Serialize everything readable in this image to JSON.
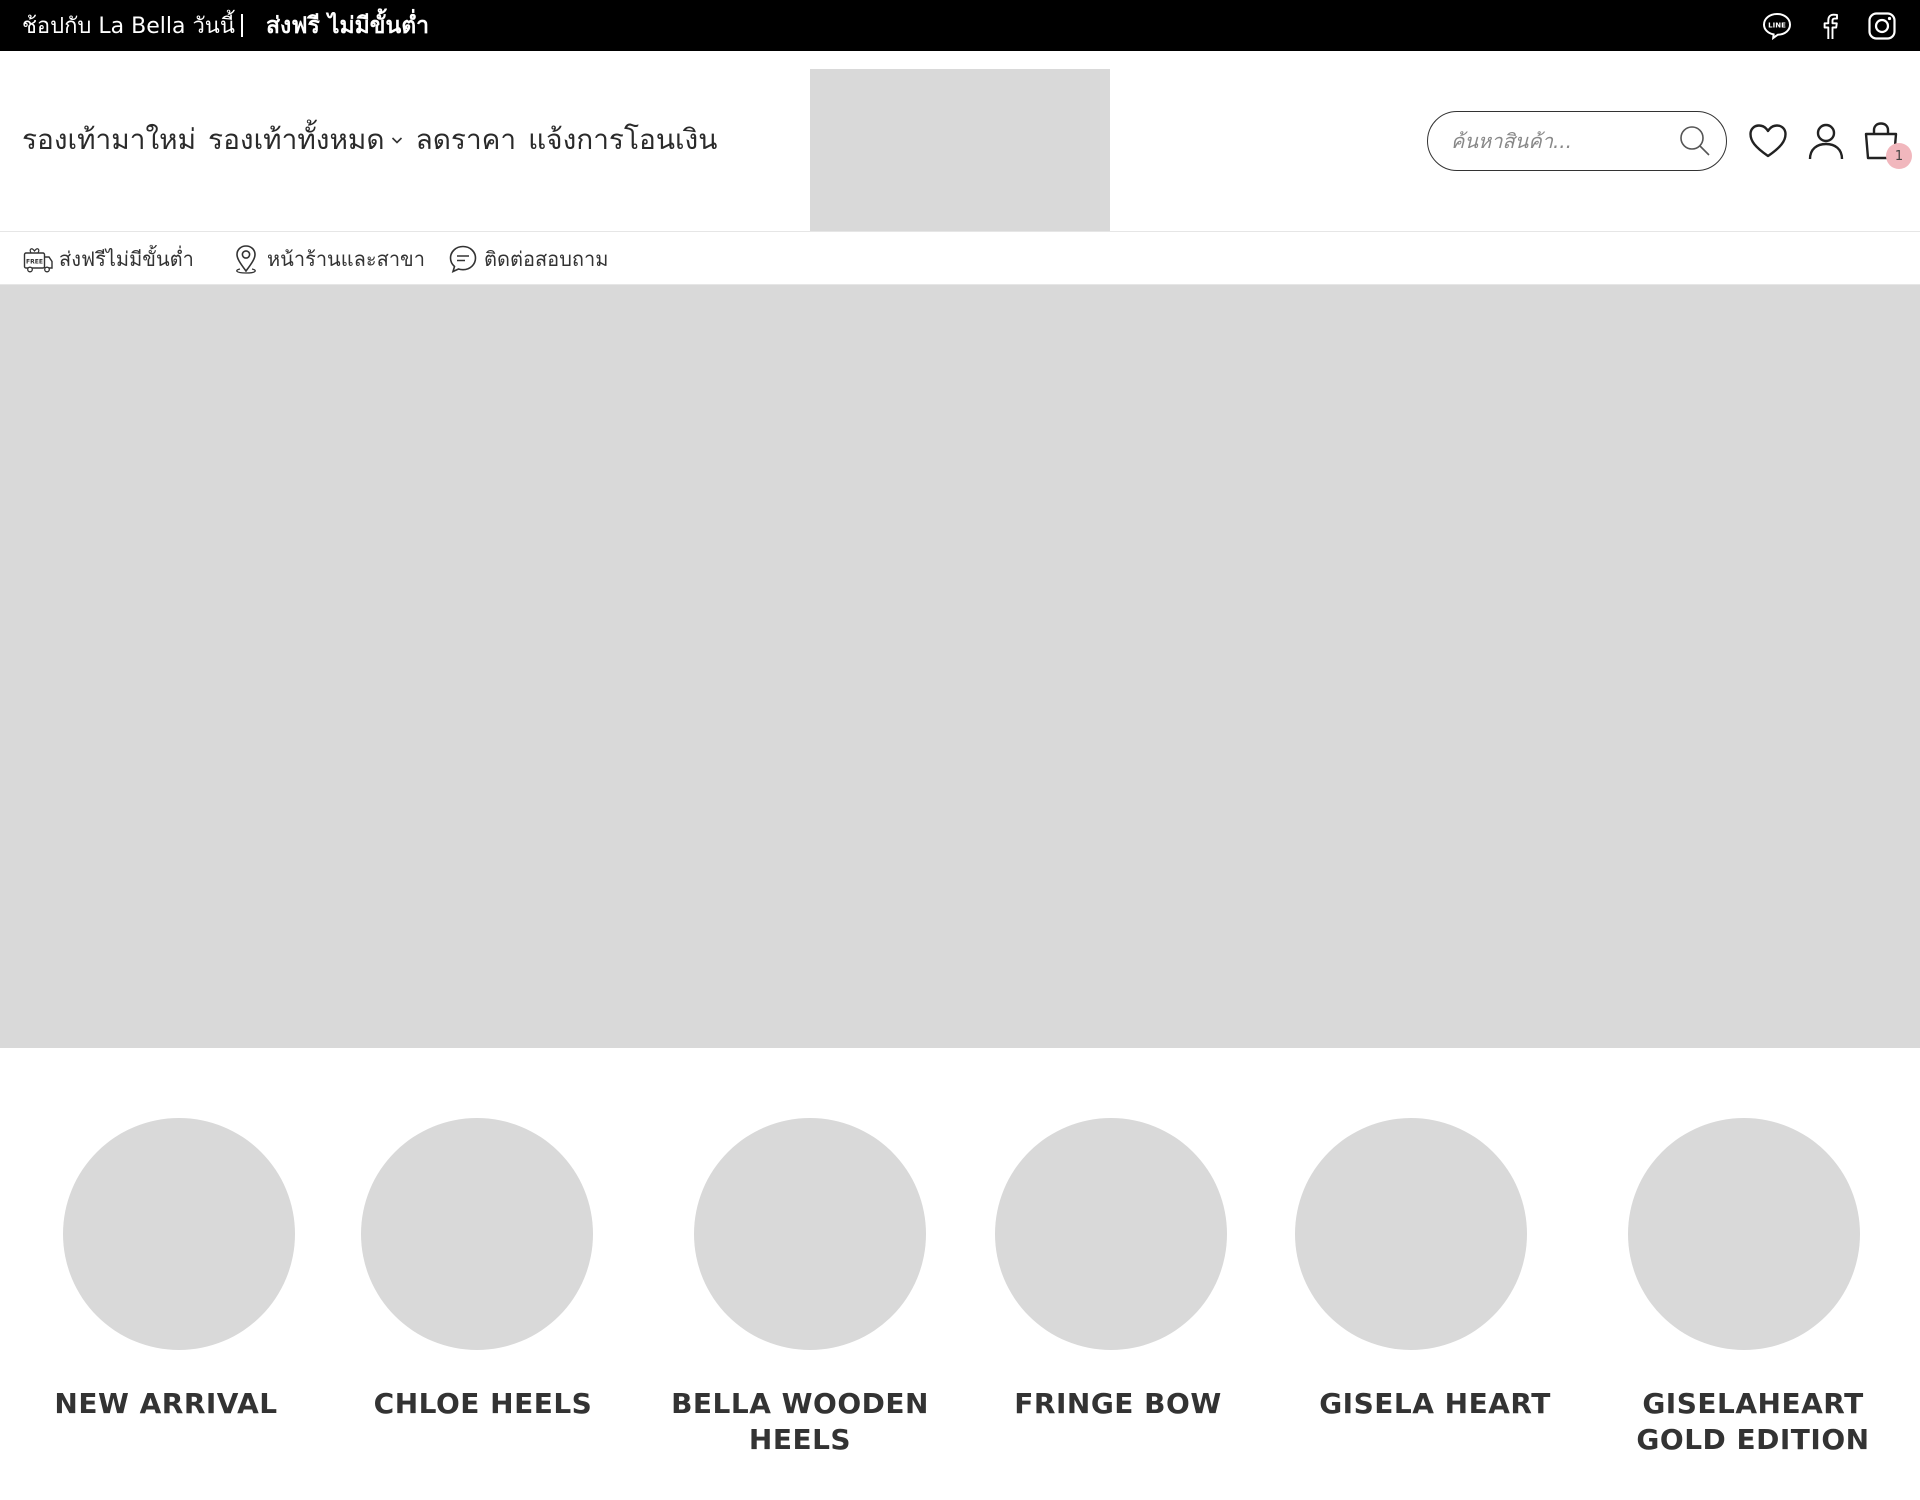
{
  "topbar": {
    "message": "ช้อปกับ La Bella วันนี้",
    "promo": "ส่งฟรี ไม่มีขั้นต่ำ",
    "social": [
      {
        "name": "line",
        "icon": "line-icon",
        "text": "LINE"
      },
      {
        "name": "facebook",
        "icon": "facebook-icon"
      },
      {
        "name": "instagram",
        "icon": "instagram-icon"
      }
    ]
  },
  "header": {
    "nav": [
      {
        "label": "รองเท้ามาใหม่"
      },
      {
        "label": "รองเท้าทั้งหมด",
        "has_dropdown": true
      },
      {
        "label": "ลดราคา"
      },
      {
        "label": "แจ้งการโอนเงิน"
      }
    ],
    "search_placeholder": "ค้นหาสินค้า...",
    "cart_count": "1",
    "icons": [
      "search-icon",
      "heart-icon",
      "user-icon",
      "cart-icon"
    ]
  },
  "infobar": [
    {
      "label": "ส่งฟรีไม่มีขั้นต่ำ",
      "icon": "free-shipping-icon",
      "icon_text": "FREE"
    },
    {
      "label": "หน้าร้านและสาขา",
      "icon": "location-pin-icon"
    },
    {
      "label": "ติดต่อสอบถาม",
      "icon": "chat-icon"
    }
  ],
  "categories": [
    {
      "label": "NEW ARRIVAL"
    },
    {
      "label": "CHLOE HEELS"
    },
    {
      "label": "BELLA WOODEN HEELS"
    },
    {
      "label": "FRINGE BOW"
    },
    {
      "label": "GISELA HEART"
    },
    {
      "label": "GISELAHEART GOLD EDITION"
    }
  ],
  "colors": {
    "topbar_bg": "#000000",
    "placeholder_gray": "#d9d9d9",
    "badge_pink": "#f1b7bd",
    "text_dark": "#2a2a2a"
  }
}
